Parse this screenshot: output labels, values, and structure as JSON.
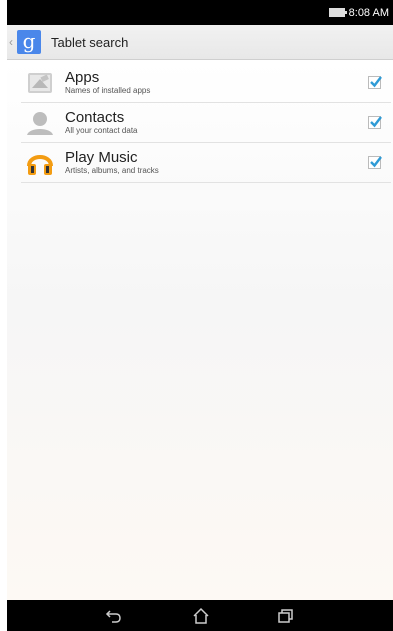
{
  "status_bar": {
    "time": "8:08 AM"
  },
  "action_bar": {
    "title": "Tablet search",
    "app_icon": "google-g-icon"
  },
  "sources": [
    {
      "title": "Apps",
      "subtitle": "Names of installed apps",
      "icon": "apps-icon",
      "checked": true
    },
    {
      "title": "Contacts",
      "subtitle": "All your contact data",
      "icon": "contacts-icon",
      "checked": true
    },
    {
      "title": "Play Music",
      "subtitle": "Artists, albums, and tracks",
      "icon": "play-music-icon",
      "checked": true
    }
  ],
  "nav_bar": {
    "buttons": [
      "back-icon",
      "home-icon",
      "recents-icon"
    ]
  },
  "colors": {
    "accent": "#4a87ea",
    "check": "#2f9bd6",
    "play_music_orange": "#f39c12"
  }
}
